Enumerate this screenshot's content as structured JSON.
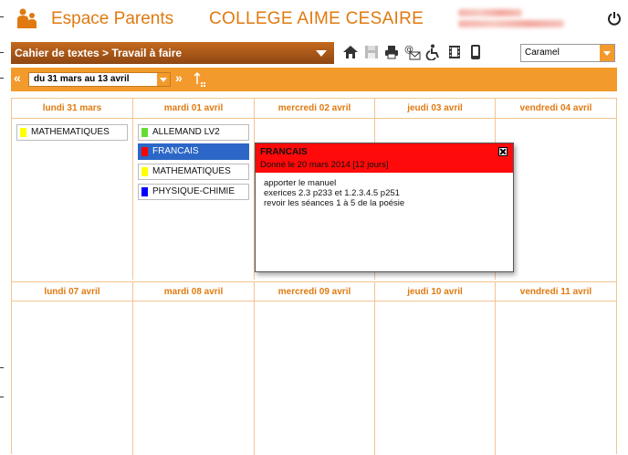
{
  "header": {
    "app_title": "Espace Parents",
    "school_name": "COLLEGE AIME CESAIRE"
  },
  "toolbar": {
    "section_label": "Cahier de textes > Travail à faire",
    "theme_value": "Caramel",
    "icons": [
      "home-icon",
      "save-icon",
      "print-icon",
      "email-icon",
      "accessibility-icon",
      "film-icon",
      "mobile-icon"
    ]
  },
  "period": {
    "prev_label": "«",
    "selected": "du 31 mars au 13 avril",
    "next_label": "»"
  },
  "week1": {
    "days": [
      "lundi 31 mars",
      "mardi 01 avril",
      "mercredi 02 avril",
      "jeudi 03 avril",
      "vendredi 04 avril"
    ]
  },
  "week2": {
    "days": [
      "lundi 07 avril",
      "mardi 08 avril",
      "mercredi 09 avril",
      "jeudi 10 avril",
      "vendredi 11 avril"
    ]
  },
  "homework": {
    "mon": [
      {
        "label": "MATHEMATIQUES",
        "color": "#ffff00"
      }
    ],
    "tue": [
      {
        "label": "ALLEMAND LV2",
        "color": "#66dd33"
      },
      {
        "label": "FRANCAIS",
        "color": "#ff0000"
      },
      {
        "label": "MATHEMATIQUES",
        "color": "#ffff00"
      },
      {
        "label": "PHYSIQUE-CHIMIE",
        "color": "#0000ff"
      }
    ]
  },
  "popup": {
    "title": "FRANCAIS",
    "date": "Donné le 20 mars 2014 [12 jours]",
    "lines": [
      "apporter le manuel",
      "exerices 2.3 p233 et 1.2.3.4.5 p251",
      "revoir les séances 1 à 5 de la poésie"
    ]
  },
  "colors": {
    "accent": "#f39a2c",
    "header_text": "#e07a10",
    "selected": "#2c67c7",
    "popup_header": "#ff0a0a"
  }
}
